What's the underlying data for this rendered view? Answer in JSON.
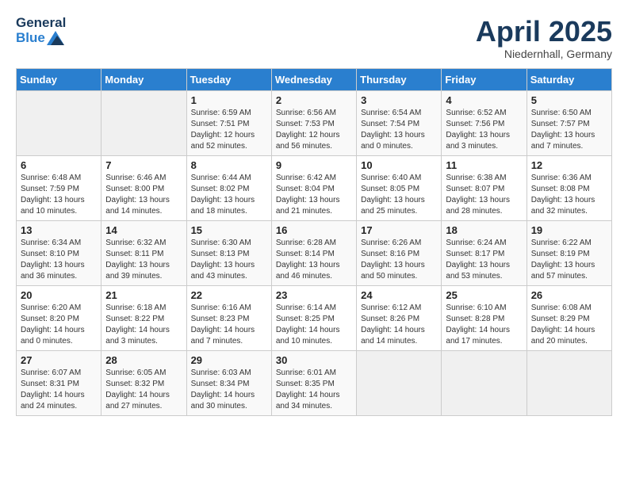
{
  "header": {
    "logo_general": "General",
    "logo_blue": "Blue",
    "title": "April 2025",
    "subtitle": "Niedernhall, Germany"
  },
  "days_of_week": [
    "Sunday",
    "Monday",
    "Tuesday",
    "Wednesday",
    "Thursday",
    "Friday",
    "Saturday"
  ],
  "weeks": [
    [
      {
        "day": "",
        "detail": ""
      },
      {
        "day": "",
        "detail": ""
      },
      {
        "day": "1",
        "detail": "Sunrise: 6:59 AM\nSunset: 7:51 PM\nDaylight: 12 hours\nand 52 minutes."
      },
      {
        "day": "2",
        "detail": "Sunrise: 6:56 AM\nSunset: 7:53 PM\nDaylight: 12 hours\nand 56 minutes."
      },
      {
        "day": "3",
        "detail": "Sunrise: 6:54 AM\nSunset: 7:54 PM\nDaylight: 13 hours\nand 0 minutes."
      },
      {
        "day": "4",
        "detail": "Sunrise: 6:52 AM\nSunset: 7:56 PM\nDaylight: 13 hours\nand 3 minutes."
      },
      {
        "day": "5",
        "detail": "Sunrise: 6:50 AM\nSunset: 7:57 PM\nDaylight: 13 hours\nand 7 minutes."
      }
    ],
    [
      {
        "day": "6",
        "detail": "Sunrise: 6:48 AM\nSunset: 7:59 PM\nDaylight: 13 hours\nand 10 minutes."
      },
      {
        "day": "7",
        "detail": "Sunrise: 6:46 AM\nSunset: 8:00 PM\nDaylight: 13 hours\nand 14 minutes."
      },
      {
        "day": "8",
        "detail": "Sunrise: 6:44 AM\nSunset: 8:02 PM\nDaylight: 13 hours\nand 18 minutes."
      },
      {
        "day": "9",
        "detail": "Sunrise: 6:42 AM\nSunset: 8:04 PM\nDaylight: 13 hours\nand 21 minutes."
      },
      {
        "day": "10",
        "detail": "Sunrise: 6:40 AM\nSunset: 8:05 PM\nDaylight: 13 hours\nand 25 minutes."
      },
      {
        "day": "11",
        "detail": "Sunrise: 6:38 AM\nSunset: 8:07 PM\nDaylight: 13 hours\nand 28 minutes."
      },
      {
        "day": "12",
        "detail": "Sunrise: 6:36 AM\nSunset: 8:08 PM\nDaylight: 13 hours\nand 32 minutes."
      }
    ],
    [
      {
        "day": "13",
        "detail": "Sunrise: 6:34 AM\nSunset: 8:10 PM\nDaylight: 13 hours\nand 36 minutes."
      },
      {
        "day": "14",
        "detail": "Sunrise: 6:32 AM\nSunset: 8:11 PM\nDaylight: 13 hours\nand 39 minutes."
      },
      {
        "day": "15",
        "detail": "Sunrise: 6:30 AM\nSunset: 8:13 PM\nDaylight: 13 hours\nand 43 minutes."
      },
      {
        "day": "16",
        "detail": "Sunrise: 6:28 AM\nSunset: 8:14 PM\nDaylight: 13 hours\nand 46 minutes."
      },
      {
        "day": "17",
        "detail": "Sunrise: 6:26 AM\nSunset: 8:16 PM\nDaylight: 13 hours\nand 50 minutes."
      },
      {
        "day": "18",
        "detail": "Sunrise: 6:24 AM\nSunset: 8:17 PM\nDaylight: 13 hours\nand 53 minutes."
      },
      {
        "day": "19",
        "detail": "Sunrise: 6:22 AM\nSunset: 8:19 PM\nDaylight: 13 hours\nand 57 minutes."
      }
    ],
    [
      {
        "day": "20",
        "detail": "Sunrise: 6:20 AM\nSunset: 8:20 PM\nDaylight: 14 hours\nand 0 minutes."
      },
      {
        "day": "21",
        "detail": "Sunrise: 6:18 AM\nSunset: 8:22 PM\nDaylight: 14 hours\nand 3 minutes."
      },
      {
        "day": "22",
        "detail": "Sunrise: 6:16 AM\nSunset: 8:23 PM\nDaylight: 14 hours\nand 7 minutes."
      },
      {
        "day": "23",
        "detail": "Sunrise: 6:14 AM\nSunset: 8:25 PM\nDaylight: 14 hours\nand 10 minutes."
      },
      {
        "day": "24",
        "detail": "Sunrise: 6:12 AM\nSunset: 8:26 PM\nDaylight: 14 hours\nand 14 minutes."
      },
      {
        "day": "25",
        "detail": "Sunrise: 6:10 AM\nSunset: 8:28 PM\nDaylight: 14 hours\nand 17 minutes."
      },
      {
        "day": "26",
        "detail": "Sunrise: 6:08 AM\nSunset: 8:29 PM\nDaylight: 14 hours\nand 20 minutes."
      }
    ],
    [
      {
        "day": "27",
        "detail": "Sunrise: 6:07 AM\nSunset: 8:31 PM\nDaylight: 14 hours\nand 24 minutes."
      },
      {
        "day": "28",
        "detail": "Sunrise: 6:05 AM\nSunset: 8:32 PM\nDaylight: 14 hours\nand 27 minutes."
      },
      {
        "day": "29",
        "detail": "Sunrise: 6:03 AM\nSunset: 8:34 PM\nDaylight: 14 hours\nand 30 minutes."
      },
      {
        "day": "30",
        "detail": "Sunrise: 6:01 AM\nSunset: 8:35 PM\nDaylight: 14 hours\nand 34 minutes."
      },
      {
        "day": "",
        "detail": ""
      },
      {
        "day": "",
        "detail": ""
      },
      {
        "day": "",
        "detail": ""
      }
    ]
  ]
}
